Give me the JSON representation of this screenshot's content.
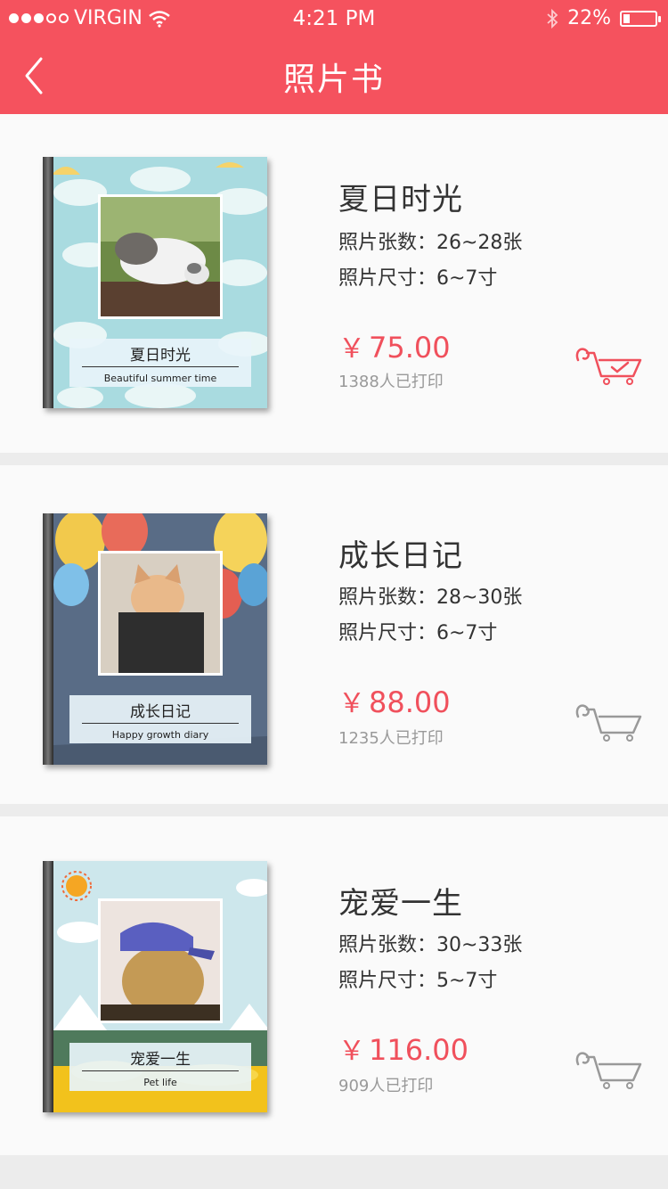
{
  "status_bar": {
    "carrier": "VIRGIN",
    "time": "4:21 PM",
    "battery_text": "22%",
    "battery_level": 0.22
  },
  "nav": {
    "title": "照片书"
  },
  "products": [
    {
      "title": "夏日时光",
      "photo_count": "照片张数：26~28张",
      "photo_size": "照片尺寸：6~7寸",
      "price_symbol": "￥",
      "price": "75.00",
      "sold": "1388人已打印",
      "cover_cn": "夏日时光",
      "cover_en": "Beautiful summer time",
      "in_cart": true
    },
    {
      "title": "成长日记",
      "photo_count": "照片张数：28~30张",
      "photo_size": "照片尺寸：6~7寸",
      "price_symbol": "￥",
      "price": "88.00",
      "sold": "1235人已打印",
      "cover_cn": "成长日记",
      "cover_en": "Happy growth diary",
      "in_cart": false
    },
    {
      "title": "宠爱一生",
      "photo_count": "照片张数：30~33张",
      "photo_size": "照片尺寸：5~7寸",
      "price_symbol": "￥",
      "price": "116.00",
      "sold": "909人已打印",
      "cover_cn": "宠爱一生",
      "cover_en": "Pet life",
      "in_cart": false
    }
  ],
  "colors": {
    "accent": "#f5525e",
    "price": "#f0505c",
    "cart_active": "#f0505c",
    "cart_inactive": "#999999"
  },
  "icons": [
    "back-icon",
    "wifi-icon",
    "bluetooth-icon",
    "battery-icon",
    "cart-icon",
    "cart-check-icon"
  ]
}
